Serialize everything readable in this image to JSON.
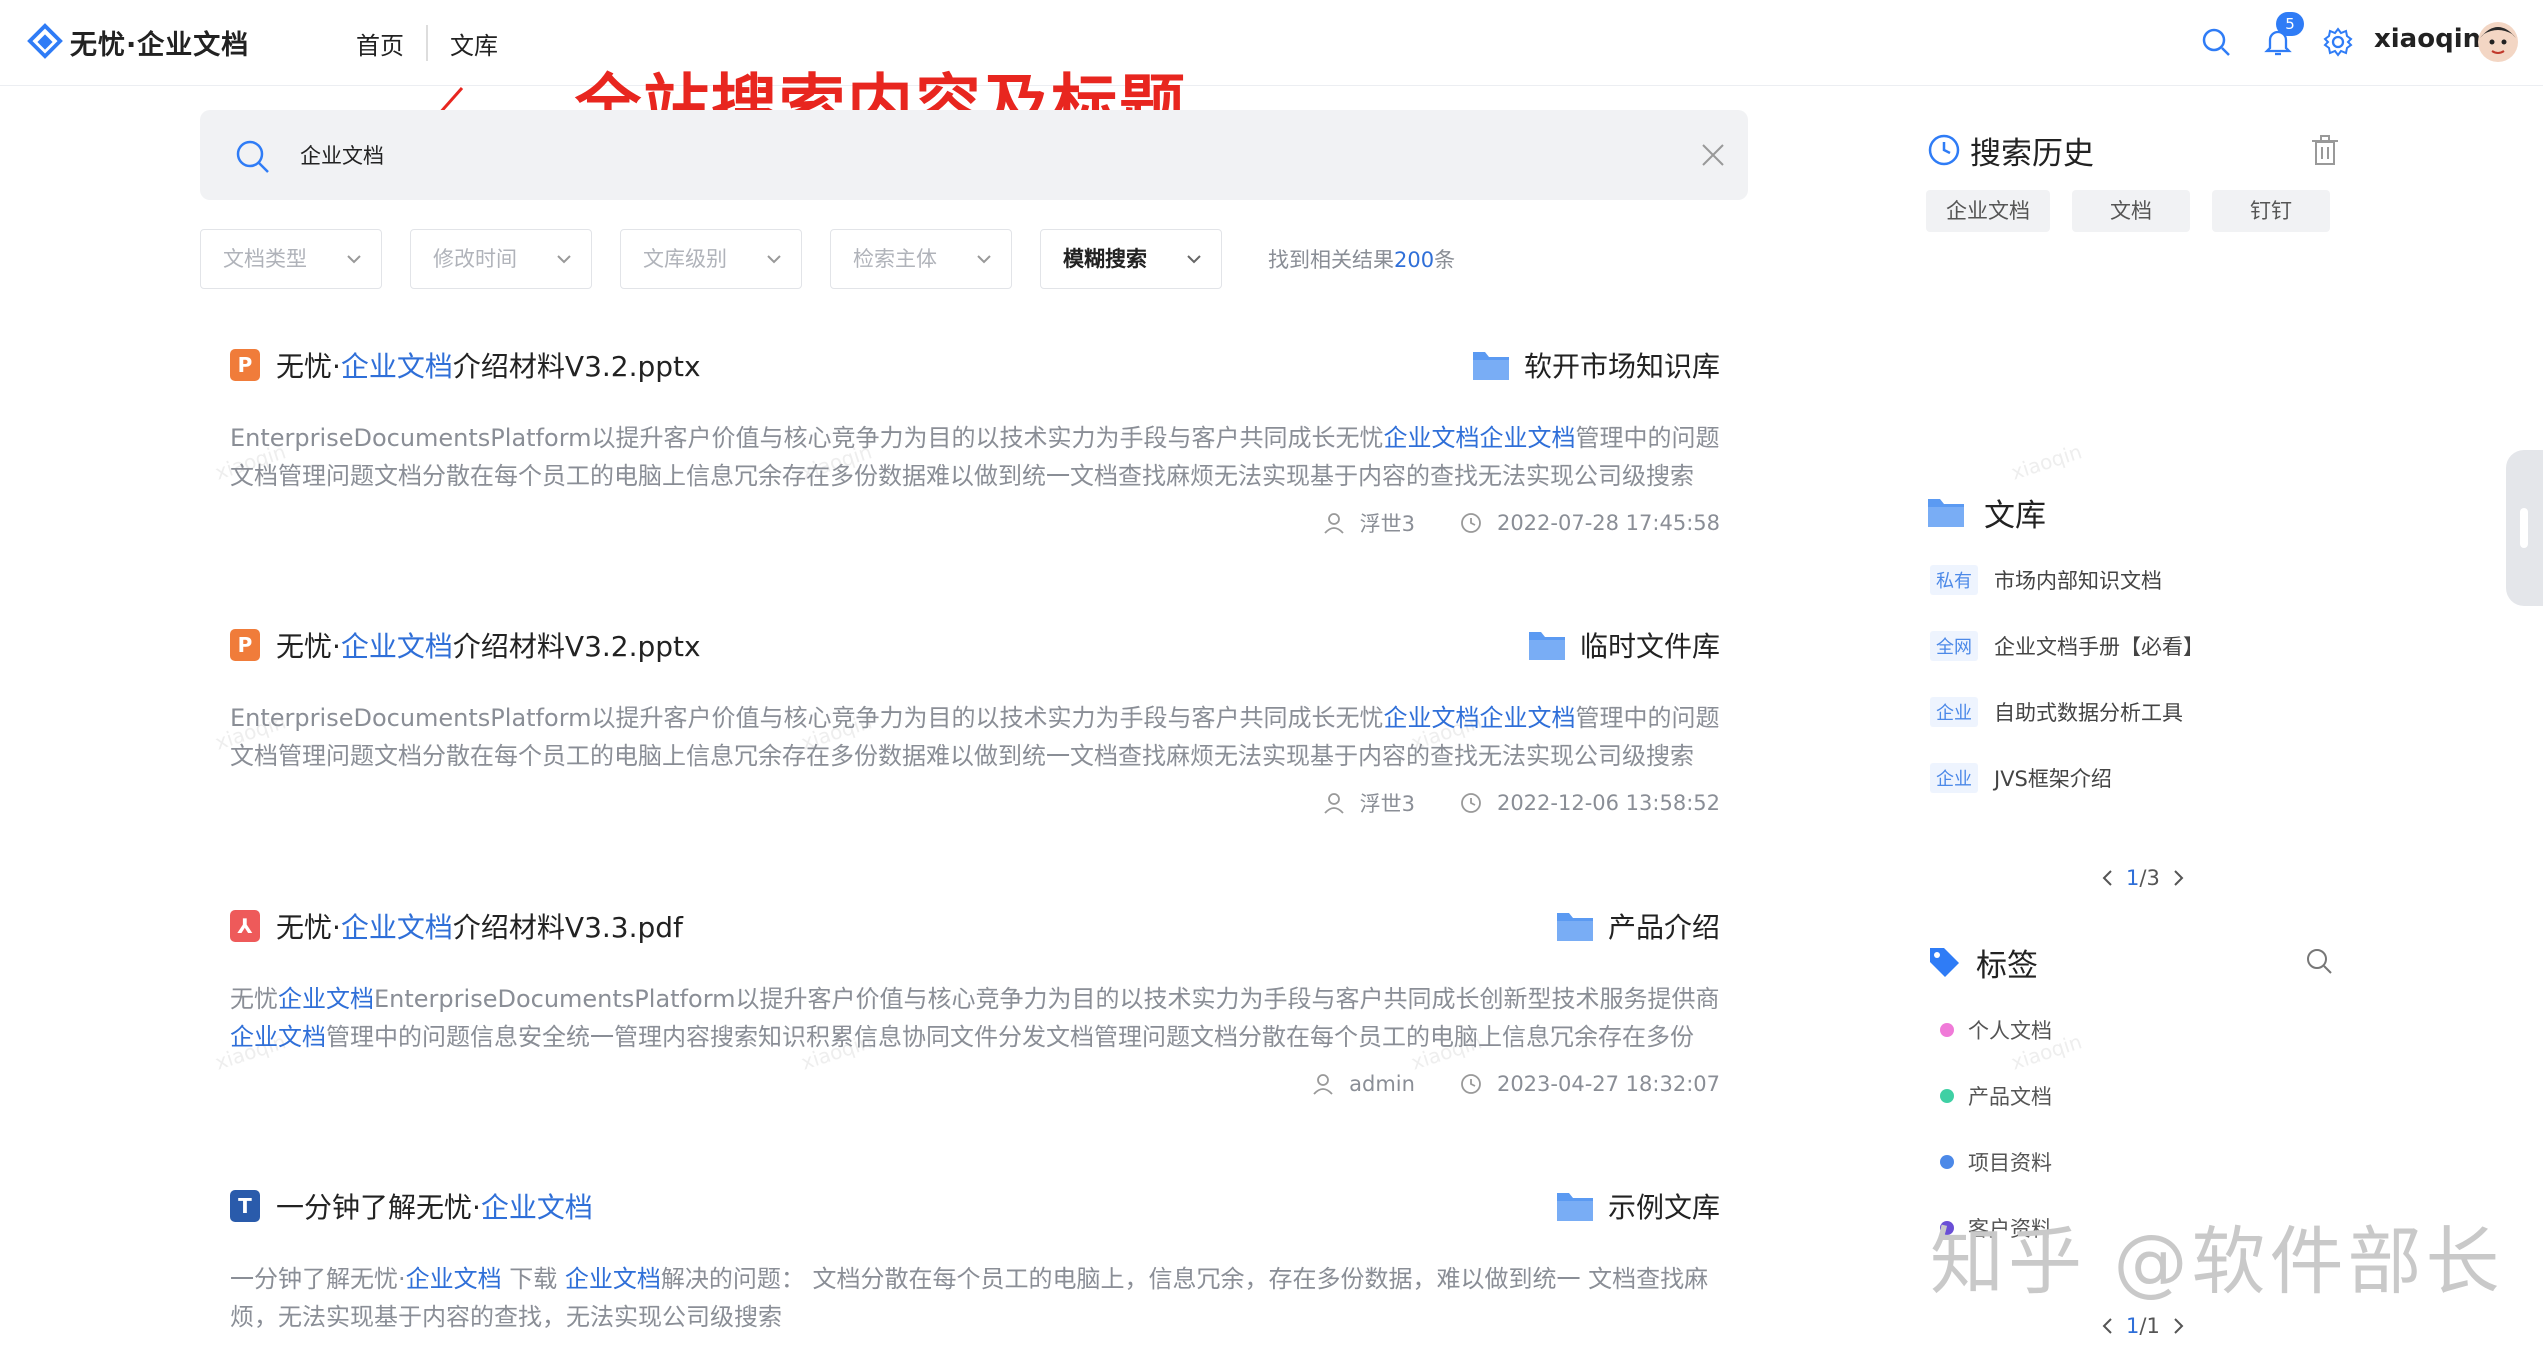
{
  "app": {
    "name": "无忧·企业文档"
  },
  "nav": {
    "home": "首页",
    "library": "文库"
  },
  "header": {
    "notification_count": "5",
    "username": "xiaoqin"
  },
  "annotation": "全站搜索内容及标题",
  "search": {
    "query": "企业文档"
  },
  "filters": {
    "doc_type": "文档类型",
    "modified_time": "修改时间",
    "library_level": "文库级别",
    "search_subject": "检索主体",
    "fuzzy_search": "模糊搜索"
  },
  "result_summary": {
    "prefix": "找到相关结果",
    "count": "200",
    "suffix": "条"
  },
  "results": [
    {
      "type": "P",
      "type_color": "#f07c3a",
      "title_pre": "无忧·",
      "title_hl": "企业文档",
      "title_post": "介绍材料V3.2.pptx",
      "library": "软开市场知识库",
      "desc_parts": [
        {
          "t": "EnterpriseDocumentsPlatform以提升客户价值与核心竞争力为目的以技术实力为手段与客户共同成长无忧",
          "hl": false
        },
        {
          "t": "企业文档企业文档",
          "hl": true
        },
        {
          "t": "管理中的问题文档管理问题文档分散在每个员工的电脑上信息冗余存在多份数据难以做到统一文档查找麻烦无法实现基于内容的查找无法实现公司级搜索文...",
          "hl": false
        }
      ],
      "author": "浮世3",
      "time": "2022-07-28 17:45:58"
    },
    {
      "type": "P",
      "type_color": "#f07c3a",
      "title_pre": "无忧·",
      "title_hl": "企业文档",
      "title_post": "介绍材料V3.2.pptx",
      "library": "临时文件库",
      "desc_parts": [
        {
          "t": "EnterpriseDocumentsPlatform以提升客户价值与核心竞争力为目的以技术实力为手段与客户共同成长无忧",
          "hl": false
        },
        {
          "t": "企业文档企业文档",
          "hl": true
        },
        {
          "t": "管理中的问题文档管理问题文档分散在每个员工的电脑上信息冗余存在多份数据难以做到统一文档查找麻烦无法实现基于内容的查找无法实现公司级搜索文...",
          "hl": false
        }
      ],
      "author": "浮世3",
      "time": "2022-12-06 13:58:52"
    },
    {
      "type": "⅄",
      "type_color": "#ee5a5a",
      "title_pre": "无忧·",
      "title_hl": "企业文档",
      "title_post": "介绍材料V3.3.pdf",
      "library": "产品介绍",
      "desc_parts": [
        {
          "t": "无忧",
          "hl": false
        },
        {
          "t": "企业文档",
          "hl": true
        },
        {
          "t": "EnterpriseDocumentsPlatform以提升客户价值与核心竞争力为目的以技术实力为手段与客户共同成长创新型技术服务提供商",
          "hl": false
        },
        {
          "t": "企业文档",
          "hl": true
        },
        {
          "t": "管理中的问题信息安全统一管理内容搜索知识积累信息协同文件分发文档管理问题文档分散在每个员工的电脑上信息冗余存在多份数...",
          "hl": false
        }
      ],
      "author": "admin",
      "time": "2023-04-27 18:32:07"
    },
    {
      "type": "T",
      "type_color": "#2a5bab",
      "title_pre": "一分钟了解无忧·",
      "title_hl": "企业文档",
      "title_post": "",
      "library": "示例文库",
      "desc_parts": [
        {
          "t": "一分钟了解无忧·",
          "hl": false
        },
        {
          "t": "企业文档",
          "hl": true
        },
        {
          "t": " 下载 ",
          "hl": false
        },
        {
          "t": "企业文档",
          "hl": true
        },
        {
          "t": "解决的问题： 文档分散在每个员工的电脑上，信息冗余，存在多份数据，难以做到统一 文档查找麻烦，无法实现基于内容的查找，无法实现公司级搜索",
          "hl": false
        }
      ],
      "author": "",
      "time": ""
    }
  ],
  "history": {
    "title": "搜索历史",
    "items": [
      "企业文档",
      "文档",
      "钉钉"
    ]
  },
  "library_panel": {
    "title": "文库",
    "items": [
      {
        "tag": "私有",
        "name": "市场内部知识文档"
      },
      {
        "tag": "全网",
        "name": "企业文档手册【必看】"
      },
      {
        "tag": "企业",
        "name": "自助式数据分析工具"
      },
      {
        "tag": "企业",
        "name": "JVS框架介绍"
      }
    ],
    "page_current": "1",
    "page_total": "/3"
  },
  "tags_panel": {
    "title": "标签",
    "items": [
      {
        "name": "个人文档",
        "color": "#f07ad8"
      },
      {
        "name": "产品文档",
        "color": "#3fd0a4"
      },
      {
        "name": "项目资料",
        "color": "#4c89e8"
      },
      {
        "name": "客户资料",
        "color": "#6a4fd6"
      }
    ],
    "page_current": "1",
    "page_total": "/1"
  },
  "watermarks": {
    "user": "xiaoqin",
    "platform": "知乎 @软件部长"
  }
}
